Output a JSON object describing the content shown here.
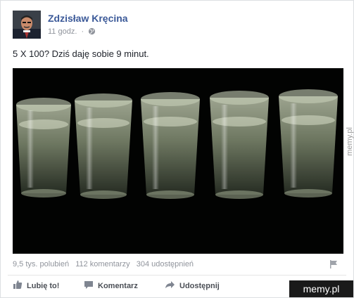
{
  "post": {
    "author": "Zdzisław Kręcina",
    "time": "11 godz.",
    "separator": "·",
    "text": "5 X 100? Dziś daję sobie 9 minut."
  },
  "stats": {
    "likes": "9,5 tys. polubień",
    "comments": "112 komentarzy",
    "shares": "304 udostępnień"
  },
  "actions": {
    "like": "Lubię to!",
    "comment": "Komentarz",
    "share": "Udostępnij"
  },
  "watermark": {
    "corner": "memy.pl",
    "side": "memy.pl"
  },
  "colors": {
    "author": "#3b5998",
    "meta": "#90949c",
    "text": "#1d2129"
  },
  "icons": [
    "globe-icon",
    "flag-icon",
    "thumbs-up-icon",
    "comment-icon",
    "share-icon"
  ]
}
